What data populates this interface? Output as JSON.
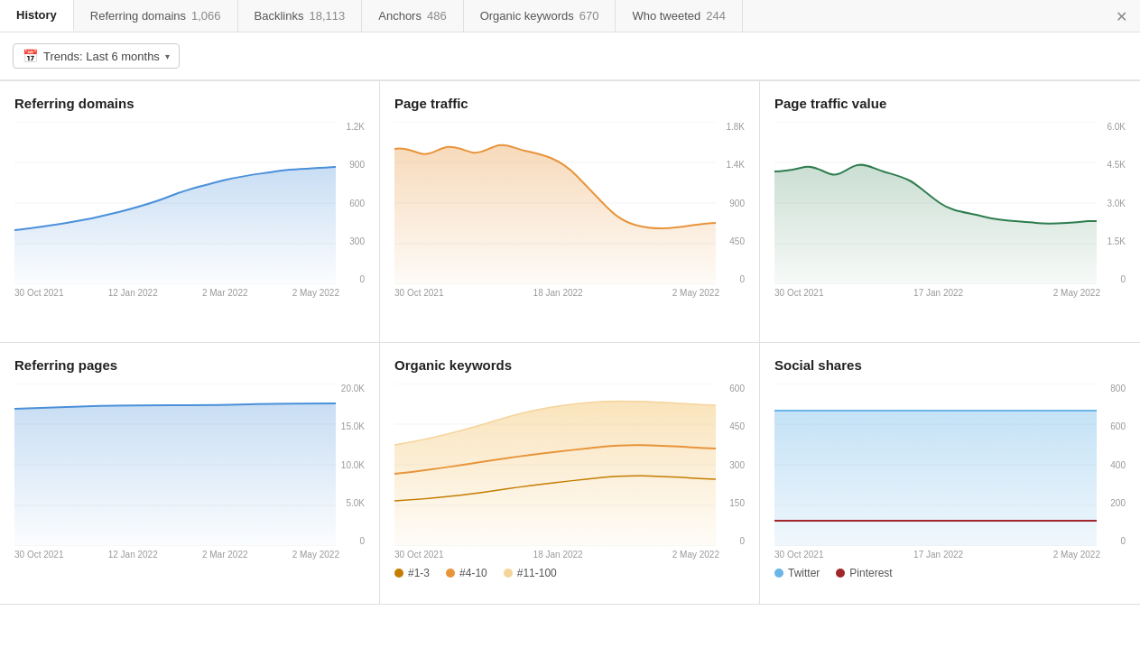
{
  "tabs": [
    {
      "id": "history",
      "label": "History",
      "count": null,
      "active": true
    },
    {
      "id": "referring-domains",
      "label": "Referring domains",
      "count": "1,066",
      "active": false
    },
    {
      "id": "backlinks",
      "label": "Backlinks",
      "count": "18,113",
      "active": false
    },
    {
      "id": "anchors",
      "label": "Anchors",
      "count": "486",
      "active": false
    },
    {
      "id": "organic-keywords",
      "label": "Organic keywords",
      "count": "670",
      "active": false
    },
    {
      "id": "who-tweeted",
      "label": "Who tweeted",
      "count": "244",
      "active": false
    }
  ],
  "toolbar": {
    "trends_label": "Trends: Last 6 months"
  },
  "charts": [
    {
      "id": "referring-domains",
      "title": "Referring domains",
      "y_labels": [
        "1.2K",
        "900",
        "600",
        "300",
        "0"
      ],
      "x_labels": [
        "30 Oct 2021",
        "12 Jan 2022",
        "2 Mar 2022",
        "2 May 2022"
      ],
      "color": "#4a90d9",
      "fill": "rgba(74,144,217,0.15)",
      "type": "area-blue"
    },
    {
      "id": "page-traffic",
      "title": "Page traffic",
      "y_labels": [
        "1.8K",
        "1.4K",
        "900",
        "450",
        "0"
      ],
      "x_labels": [
        "30 Oct 2021",
        "18 Jan 2022",
        "2 May 2022"
      ],
      "color": "#e8943a",
      "fill": "rgba(232,148,58,0.2)",
      "type": "area-orange"
    },
    {
      "id": "page-traffic-value",
      "title": "Page traffic value",
      "y_labels": [
        "6.0K",
        "4.5K",
        "3.0K",
        "1.5K",
        "0"
      ],
      "x_labels": [
        "30 Oct 2021",
        "17 Jan 2022",
        "2 May 2022"
      ],
      "color": "#2e7d4f",
      "fill": "rgba(46,125,79,0.12)",
      "type": "area-green"
    },
    {
      "id": "referring-pages",
      "title": "Referring pages",
      "y_labels": [
        "20.0K",
        "15.0K",
        "10.0K",
        "5.0K",
        "0"
      ],
      "x_labels": [
        "30 Oct 2021",
        "12 Jan 2022",
        "2 Mar 2022",
        "2 May 2022"
      ],
      "color": "#4a90d9",
      "fill": "rgba(74,144,217,0.15)",
      "type": "area-blue-flat"
    },
    {
      "id": "organic-keywords",
      "title": "Organic keywords",
      "y_labels": [
        "600",
        "450",
        "300",
        "150",
        "0"
      ],
      "x_labels": [
        "30 Oct 2021",
        "18 Jan 2022",
        "2 May 2022"
      ],
      "color": "#e8943a",
      "fill": "rgba(232,148,58,0.2)",
      "type": "organic",
      "legend": [
        {
          "label": "#1-3",
          "color": "#c47d00"
        },
        {
          "label": "#4-10",
          "color": "#e8943a"
        },
        {
          "label": "#11-100",
          "color": "#f5d49a"
        }
      ]
    },
    {
      "id": "social-shares",
      "title": "Social shares",
      "y_labels": [
        "800",
        "600",
        "400",
        "200",
        "0"
      ],
      "x_labels": [
        "30 Oct 2021",
        "17 Jan 2022",
        "2 May 2022"
      ],
      "type": "social",
      "legend": [
        {
          "label": "Twitter",
          "color": "#6bb5e8"
        },
        {
          "label": "Pinterest",
          "color": "#a0282a"
        }
      ]
    }
  ]
}
